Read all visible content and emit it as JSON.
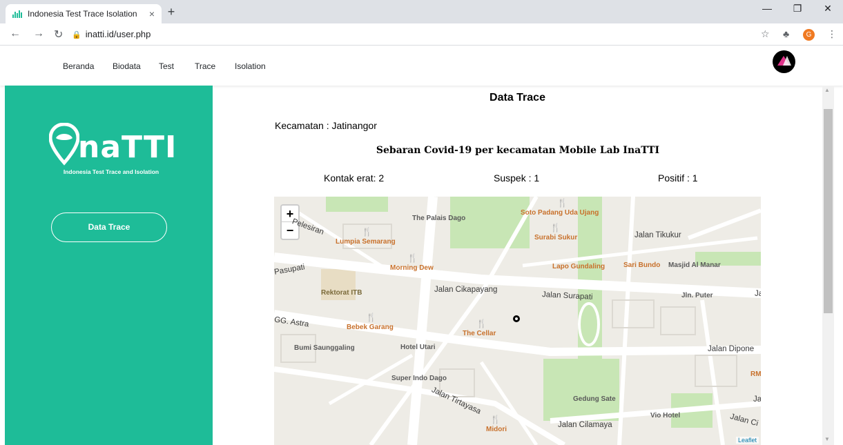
{
  "browser": {
    "tab_title": "Indonesia Test Trace Isolation",
    "tab_close": "×",
    "new_tab": "+",
    "url": "inatti.id/user.php"
  },
  "navbar": {
    "items": [
      "Beranda",
      "Biodata",
      "Test",
      "Trace",
      "Isolation"
    ]
  },
  "sidebar": {
    "logo_text": "naTTI",
    "logo_subtitle": "Indonesia Test Trace and Isolation",
    "button_label": "Data Trace"
  },
  "main": {
    "title": "Data Trace",
    "kecamatan": "Kecamatan : Jatinangor",
    "subtitle": "Sebaran Covid-19 per kecamatan Mobile Lab InaTTI",
    "kontak_erat": "Kontak erat: 2",
    "suspek": "Suspek : 1",
    "positif": "Positif : 1"
  },
  "map": {
    "zoom_in": "+",
    "zoom_out": "−",
    "attribution": "Leaflet",
    "pois": {
      "palais": "The Palais Dago",
      "soto": "Soto Padang Uda Ujang",
      "lumpia": "Lumpia Semarang",
      "surabi": "Surabi Sukur",
      "morning": "Morning Dew",
      "lapo": "Lapo Gundaling",
      "sari": "Sari Bundo",
      "masjid": "Masjid Al Manar",
      "rektorat": "Rektorat ITB",
      "bebek": "Bebek Garang",
      "cellar": "The Cellar",
      "bumi": "Bumi Saunggaling",
      "hotelutari": "Hotel Utari",
      "superindo": "Super Indo Dago",
      "gedung": "Gedung Sate",
      "vio": "Vio Hotel",
      "midori": "Midori",
      "rm": "RM",
      "jlnputer": "Jln. Puter"
    },
    "streets": {
      "pelesiran": "Pelesiran",
      "pasupati": "Pasupati",
      "tikukur": "Jalan Tikukur",
      "cikapayang": "Jalan Cikapayang",
      "surapati": "Jalan Surapati",
      "astra": "GG. Astra",
      "diponegoro": "Jalan Dipone",
      "tirtayasa": "Jalan Tirtayasa",
      "cilamaya": "Jalan Cilamaya",
      "cis": "Jalan Ci",
      "ja1": "Ja",
      "ja2": "Ja"
    }
  }
}
